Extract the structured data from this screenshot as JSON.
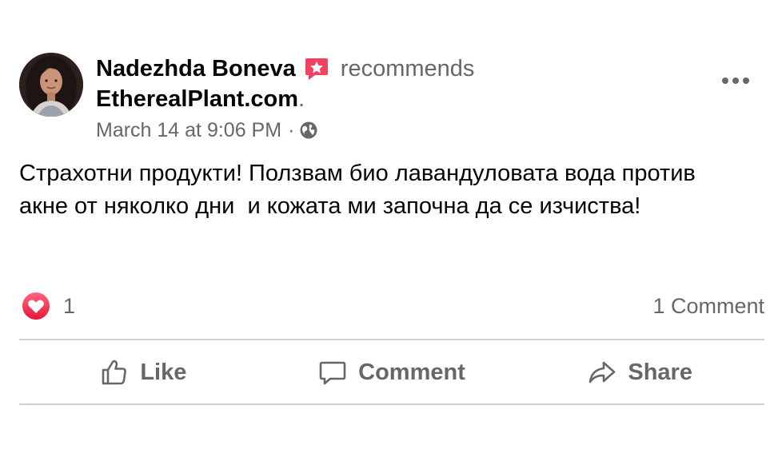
{
  "post": {
    "author_name": "Nadezhda Boneva",
    "action_text": "recommends",
    "page_name": "EtherealPlant.com",
    "page_suffix": ".",
    "timestamp": "March 14 at 9:06 PM",
    "separator": "·",
    "privacy_icon": "globe-icon",
    "body_line1": "Страхотни продукти! Ползвам био лавандуловата вода против",
    "body_line2": "акне от няколко дни  и кожата ми започна да се изчиства!"
  },
  "engagement": {
    "reaction_icon": "heart-reaction-icon",
    "reaction_count": "1",
    "comment_count": "1 Comment"
  },
  "actions": {
    "like_label": "Like",
    "comment_label": "Comment",
    "share_label": "Share"
  },
  "colors": {
    "text_primary": "#050505",
    "text_secondary": "#65676b",
    "divider": "#ced0d4",
    "recommend_badge": "#f3425f",
    "heart_reaction": "#f33e58"
  }
}
